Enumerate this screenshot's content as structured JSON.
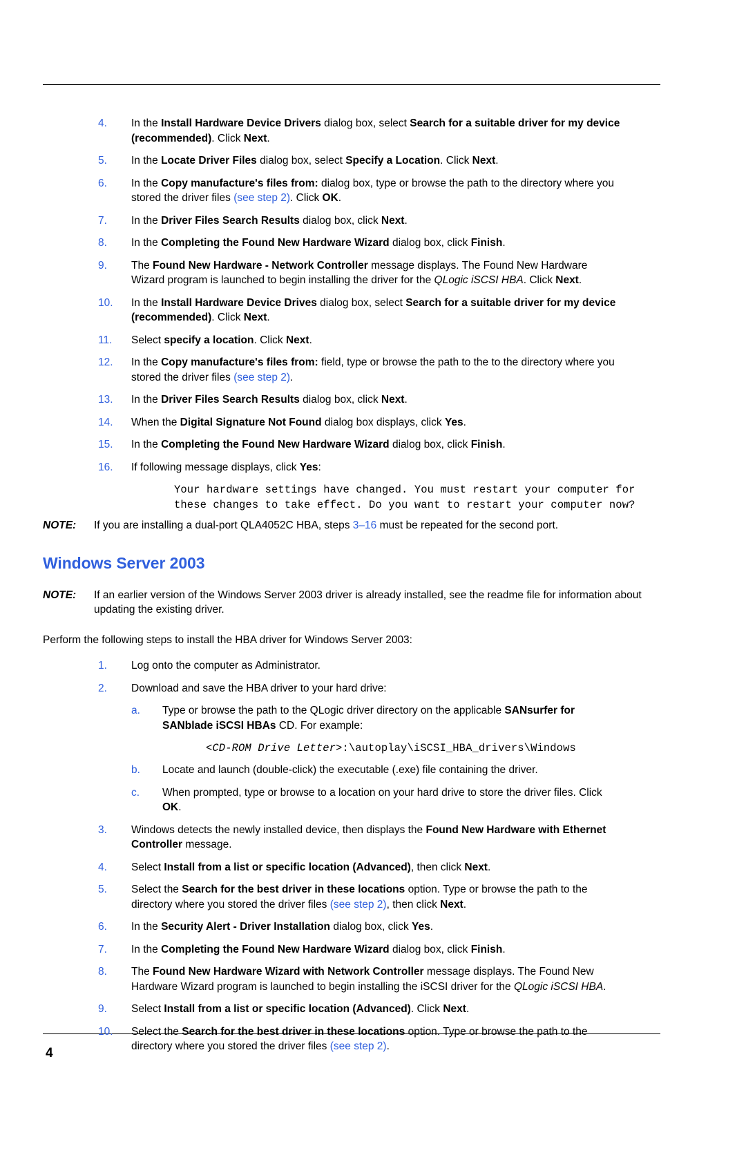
{
  "page": {
    "folio": "4"
  },
  "win2000_steps": [
    {
      "num": "4.",
      "html": "In the <b>Install Hardware Device Drivers</b> dialog box, select <b>Search for a suitable driver for my device (recommended)</b>. Click <b>Next</b>."
    },
    {
      "num": "5.",
      "html": "In the <b>Locate Driver Files</b> dialog box, select <b>Specify a Location</b>. Click <b>Next</b>."
    },
    {
      "num": "6.",
      "html": "In the <b>Copy manufacture's files from:</b> dialog box, type or browse the path to the directory where you stored the driver files <span class=\"blue\">(see step 2)</span>. Click <b>OK</b>."
    },
    {
      "num": "7.",
      "html": "In the <b>Driver Files Search Results</b> dialog box, click <b>Next</b>."
    },
    {
      "num": "8.",
      "html": "In the <b>Completing the Found New Hardware Wizard</b> dialog box, click <b>Finish</b>."
    },
    {
      "num": "9.",
      "html": "The <b>Found New Hardware - Network Controller</b> message displays. The Found New Hardware Wizard program is launched to begin installing the driver for the <i>QLogic iSCSI HBA</i>. Click <b>Next</b>."
    },
    {
      "num": "10.",
      "html": "In the <b>Install Hardware Device Drives</b> dialog box, select <b>Search for a suitable driver for my device (recommended)</b>. Click <b>Next</b>."
    },
    {
      "num": "11.",
      "html": "Select <b>specify a location</b>. Click <b>Next</b>."
    },
    {
      "num": "12.",
      "html": "In the <b>Copy manufacture's files from:</b> field, type or browse the path to the to the directory where you stored the driver files <span class=\"blue\">(see step 2)</span>."
    },
    {
      "num": "13.",
      "html": "In the <b>Driver Files Search Results</b> dialog box, click <b>Next</b>."
    },
    {
      "num": "14.",
      "html": "When the <b>Digital Signature Not Found</b> dialog box displays, click <b>Yes</b>."
    },
    {
      "num": "15.",
      "html": "In the <b>Completing the Found New Hardware Wizard</b> dialog box, click <b>Finish</b>."
    },
    {
      "num": "16.",
      "html": "If following message displays, click <b>Yes</b>:"
    }
  ],
  "restart_message": "Your hardware settings have changed. You must restart your computer for these changes to take effect. Do you want to restart your computer now?",
  "note_dualport": {
    "label": "NOTE:",
    "html": "If you are installing a dual-port QLA4052C HBA, steps <span class=\"blue\">3–16</span> must be repeated for the second port."
  },
  "section": {
    "heading": "Windows Server 2003"
  },
  "note_earlier": {
    "label": "NOTE:",
    "html": "If an earlier version of the Windows Server 2003 driver is already installed, see the readme file for information about updating the existing driver."
  },
  "intro_para": "Perform the following steps to install the HBA driver for Windows Server 2003:",
  "win2003_steps_a": [
    {
      "num": "1.",
      "html": "Log onto the computer as Administrator."
    },
    {
      "num": "2.",
      "html": "Download and save the HBA driver to your hard drive:"
    }
  ],
  "win2003_substeps": [
    {
      "num": "a.",
      "html": "Type or browse the path to the QLogic driver directory on the applicable <b>SANsurfer for SANblade iSCSI HBAs</b> CD. For example:"
    },
    {
      "num": "b.",
      "html": "Locate and launch (double-click) the executable (.exe) file containing the driver."
    },
    {
      "num": "c.",
      "html": "When prompted, type or browse to a location on your hard drive to store the driver files. Click <b>OK</b>."
    }
  ],
  "cdrom_path": "<CD-ROM Drive Letter>:\\autoplay\\iSCSI_HBA_drivers\\Windows",
  "cdrom_path_italic": "<CD-ROM Drive Letter>",
  "cdrom_path_rest": ":\\autoplay\\iSCSI_HBA_drivers\\Windows",
  "win2003_steps_b": [
    {
      "num": "3.",
      "html": "Windows detects the newly installed device, then displays the <b>Found New Hardware with Ethernet Controller</b> message."
    },
    {
      "num": "4.",
      "html": "Select <b>Install from a list or specific location (Advanced)</b>, then click <b>Next</b>."
    },
    {
      "num": "5.",
      "html": "Select the <b>Search for the best driver in these locations</b> option. Type or browse the path to the directory where you stored the driver files <span class=\"blue\">(see step 2)</span>, then click <b>Next</b>."
    },
    {
      "num": "6.",
      "html": "In the <b>Security Alert - Driver Installation</b> dialog box, click <b>Yes</b>."
    },
    {
      "num": "7.",
      "html": "In the <b>Completing the Found New Hardware Wizard</b> dialog box, click <b>Finish</b>."
    },
    {
      "num": "8.",
      "html": "The <b>Found New Hardware Wizard with Network Controller</b> message displays. The Found New Hardware Wizard program is launched to begin installing the iSCSI driver for the <i>QLogic iSCSI HBA</i>."
    },
    {
      "num": "9.",
      "html": "Select <b>Install from a list or specific location (Advanced)</b>. Click <b>Next</b>."
    },
    {
      "num": "10.",
      "html": "Select the <b>Search for the best driver in these locations</b> option. Type or browse the path to the directory where you stored the driver files <span class=\"blue\">(see step 2)</span>."
    }
  ],
  "colors": {
    "accent_blue": "#2f5fdd",
    "text_black": "#000000",
    "page_background": "#ffffff"
  }
}
